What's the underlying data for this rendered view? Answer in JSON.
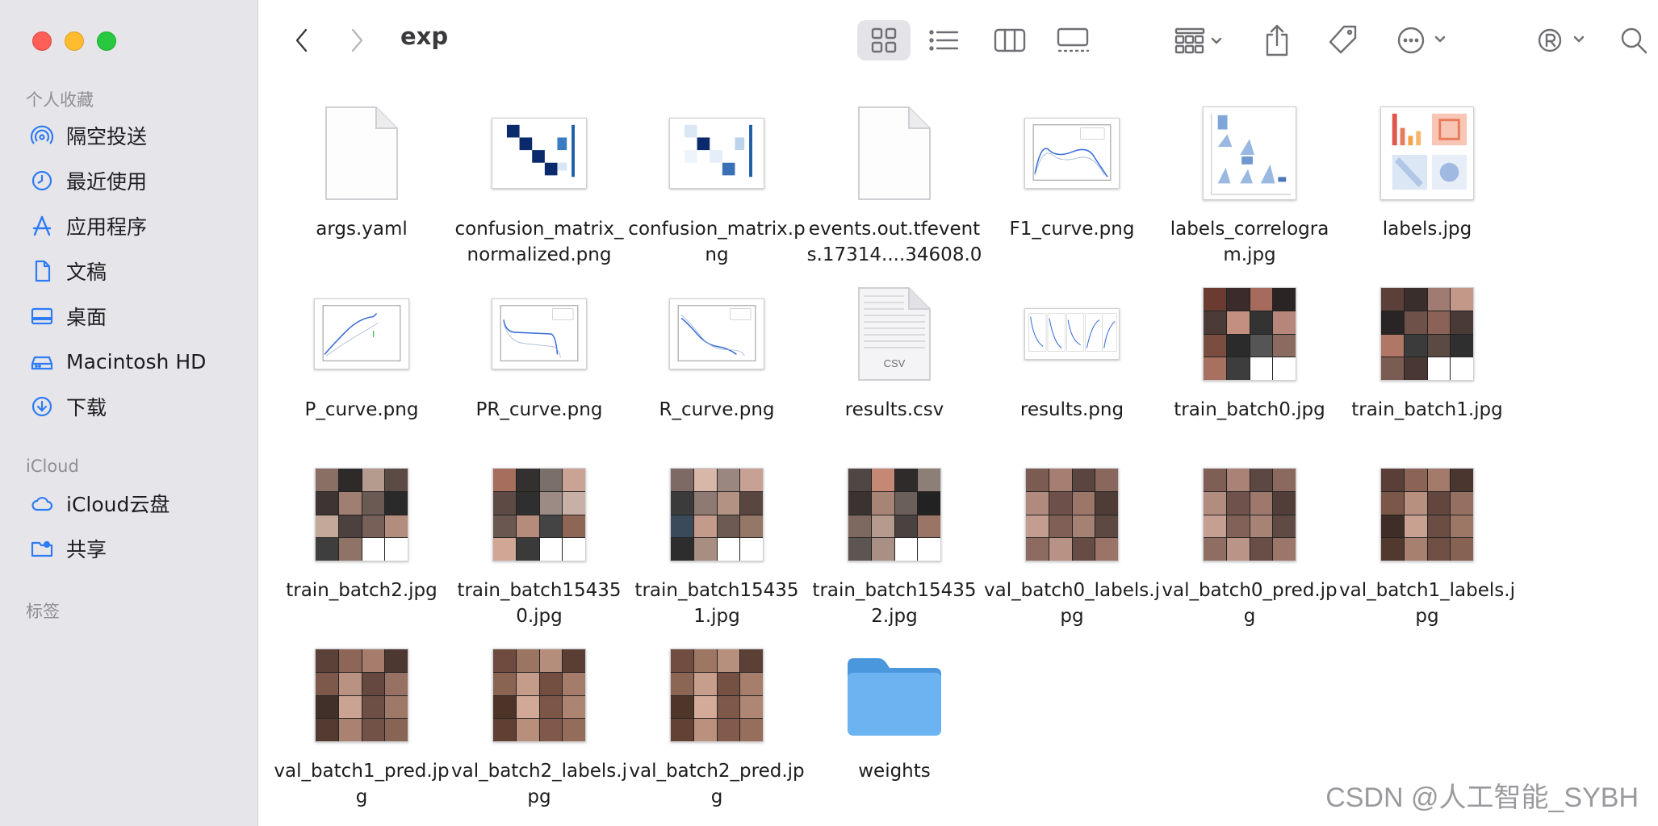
{
  "window": {
    "title": "exp"
  },
  "sidebar": {
    "favorites_header": "个人收藏",
    "icloud_header": "iCloud",
    "tags_header": "标签",
    "favorites": [
      {
        "label": "隔空投送",
        "icon": "airdrop-icon"
      },
      {
        "label": "最近使用",
        "icon": "clock-icon"
      },
      {
        "label": "应用程序",
        "icon": "applications-icon"
      },
      {
        "label": "文稿",
        "icon": "document-icon"
      },
      {
        "label": "桌面",
        "icon": "desktop-icon"
      },
      {
        "label": "Macintosh HD",
        "icon": "disk-icon"
      },
      {
        "label": "下载",
        "icon": "download-icon"
      }
    ],
    "icloud": [
      {
        "label": "iCloud云盘",
        "icon": "cloud-icon"
      },
      {
        "label": "共享",
        "icon": "shared-folder-icon"
      }
    ]
  },
  "toolbar": {
    "icons": [
      "back-icon",
      "forward-icon",
      "icon-view-icon",
      "list-view-icon",
      "column-view-icon",
      "gallery-view-icon",
      "group-icon",
      "share-icon",
      "tag-icon",
      "more-icon",
      "r-icon",
      "search-icon"
    ]
  },
  "files": [
    {
      "name": "args.yaml",
      "kind": "doc"
    },
    {
      "name": "confusion_matrix_normalized.png",
      "kind": "matrix"
    },
    {
      "name": "confusion_matrix.png",
      "kind": "matrix2"
    },
    {
      "name": "events.out.tfevents.17314....34608.0",
      "kind": "doc"
    },
    {
      "name": "F1_curve.png",
      "kind": "curve"
    },
    {
      "name": "labels_correlogram.jpg",
      "kind": "correlogram"
    },
    {
      "name": "labels.jpg",
      "kind": "labels"
    },
    {
      "name": "P_curve.png",
      "kind": "curve"
    },
    {
      "name": "PR_curve.png",
      "kind": "curve"
    },
    {
      "name": "R_curve.png",
      "kind": "curve"
    },
    {
      "name": "results.csv",
      "kind": "csv",
      "badge": "CSV"
    },
    {
      "name": "results.png",
      "kind": "results"
    },
    {
      "name": "train_batch0.jpg",
      "kind": "mosaic-train"
    },
    {
      "name": "train_batch1.jpg",
      "kind": "mosaic-train"
    },
    {
      "name": "train_batch2.jpg",
      "kind": "mosaic-train"
    },
    {
      "name": "train_batch154350.jpg",
      "kind": "mosaic-train"
    },
    {
      "name": "train_batch154351.jpg",
      "kind": "mosaic-train"
    },
    {
      "name": "train_batch154352.jpg",
      "kind": "mosaic-train"
    },
    {
      "name": "val_batch0_labels.jpg",
      "kind": "mosaic-val"
    },
    {
      "name": "val_batch0_pred.jpg",
      "kind": "mosaic-val"
    },
    {
      "name": "val_batch1_labels.jpg",
      "kind": "mosaic-val"
    },
    {
      "name": "val_batch1_pred.jpg",
      "kind": "mosaic-val"
    },
    {
      "name": "val_batch2_labels.jpg",
      "kind": "mosaic-val"
    },
    {
      "name": "val_batch2_pred.jpg",
      "kind": "mosaic-val"
    },
    {
      "name": "weights",
      "kind": "folder"
    }
  ],
  "watermark": "CSDN @人工智能_SYBH",
  "colors": {
    "sidebar_bg": "#e6e6ea",
    "folder": "#5aa9ec",
    "accent": "#0a60ff"
  }
}
